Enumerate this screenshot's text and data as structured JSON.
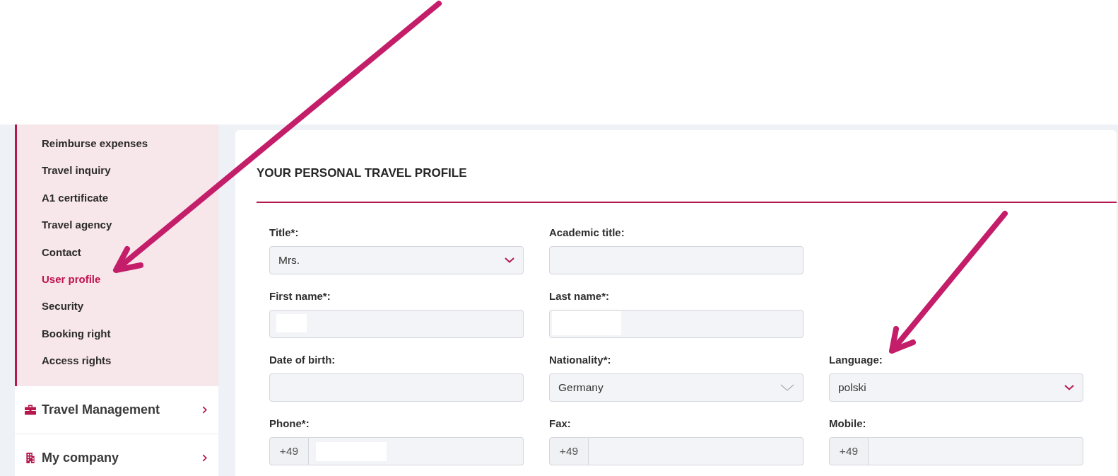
{
  "sidebar": {
    "submenu": [
      {
        "label": "Reimburse expenses",
        "selected": false
      },
      {
        "label": "Travel inquiry",
        "selected": false
      },
      {
        "label": "A1 certificate",
        "selected": false
      },
      {
        "label": "Travel agency",
        "selected": false
      },
      {
        "label": "Contact",
        "selected": false
      },
      {
        "label": "User profile",
        "selected": true
      },
      {
        "label": "Security",
        "selected": false
      },
      {
        "label": "Booking right",
        "selected": false
      },
      {
        "label": "Access rights",
        "selected": false
      }
    ],
    "sections": [
      {
        "label": "Travel Management"
      },
      {
        "label": "My company"
      }
    ]
  },
  "form": {
    "title": "YOUR PERSONAL TRAVEL PROFILE",
    "rows": [
      {
        "fields": [
          {
            "kind": "select",
            "label": "Title*:",
            "value": "Mrs."
          },
          {
            "kind": "text",
            "label": "Academic title:",
            "redacted": false
          }
        ]
      },
      {
        "fields": [
          {
            "kind": "text",
            "label": "First name*:",
            "redacted": true
          },
          {
            "kind": "text",
            "label": "Last name*:",
            "redacted": true
          }
        ]
      },
      {
        "fields": [
          {
            "kind": "text",
            "label": "Date of birth:",
            "redacted": false
          },
          {
            "kind": "combobox",
            "label": "Nationality*:",
            "value": "Germany"
          },
          {
            "kind": "select",
            "label": "Language:",
            "value": "polski"
          }
        ]
      },
      {
        "fields": [
          {
            "kind": "phone",
            "label": "Phone*:",
            "prefix": "+49",
            "redacted": true
          },
          {
            "kind": "phone",
            "label": "Fax:",
            "prefix": "+49",
            "redacted": false
          },
          {
            "kind": "phone",
            "label": "Mobile:",
            "prefix": "+49",
            "redacted": false
          }
        ]
      }
    ]
  }
}
